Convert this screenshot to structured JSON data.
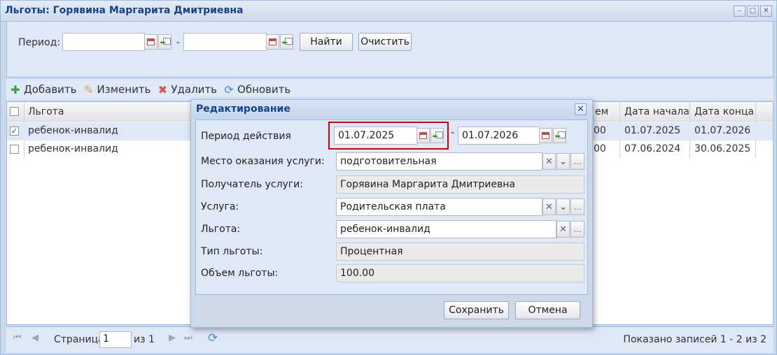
{
  "window": {
    "title": "Льготы: Горявина Маргарита Дмитриевна",
    "buttons": [
      "–",
      "□",
      "✕"
    ]
  },
  "filter": {
    "period_label": "Период:",
    "from_value": "",
    "dash": "-",
    "to_value": "",
    "find_label": "Найти",
    "clear_label": "Очистить"
  },
  "toolbar": {
    "add_label": "Добавить",
    "edit_label": "Изменить",
    "delete_label": "Удалить",
    "refresh_label": "Обновить"
  },
  "grid": {
    "columns": [
      "Льгота",
      "ем",
      "Дата начала",
      "Дата конца"
    ],
    "rows": [
      {
        "benefit": "ребенок-инвалид",
        "amount": "00",
        "start": "01.07.2025",
        "end": "01.07.2026",
        "checked": true
      },
      {
        "benefit": "ребенок-инвалид",
        "amount": "00",
        "start": "07.06.2024",
        "end": "30.06.2025",
        "checked": false
      }
    ]
  },
  "pager": {
    "page_label": "Страница",
    "page_value": "1",
    "of_label": "из 1",
    "summary": "Показано записей 1 - 2 из 2"
  },
  "modal": {
    "title": "Редактирование",
    "close": "✕",
    "fields": {
      "period_label": "Период действия",
      "period_from": "01.07.2025",
      "period_dash": "-",
      "period_to": "01.07.2026",
      "place_label": "Место оказания услуги:",
      "place_value": "подготовительная",
      "recipient_label": "Получатель услуги:",
      "recipient_value": "Горявина Маргарита Дмитриевна",
      "service_label": "Услуга:",
      "service_value": "Родительская плата",
      "benefit_label": "Льгота:",
      "benefit_value": "ребенок-инвалид",
      "type_label": "Тип льготы:",
      "type_value": "Процентная",
      "volume_label": "Объем льготы:",
      "volume_value": "100.00"
    },
    "save_label": "Сохранить",
    "cancel_label": "Отмена"
  },
  "colors": {
    "title_text": "#15428b",
    "panel_bg": "#dfe8f6",
    "border": "#99bbe8",
    "highlight": "#d40000"
  }
}
